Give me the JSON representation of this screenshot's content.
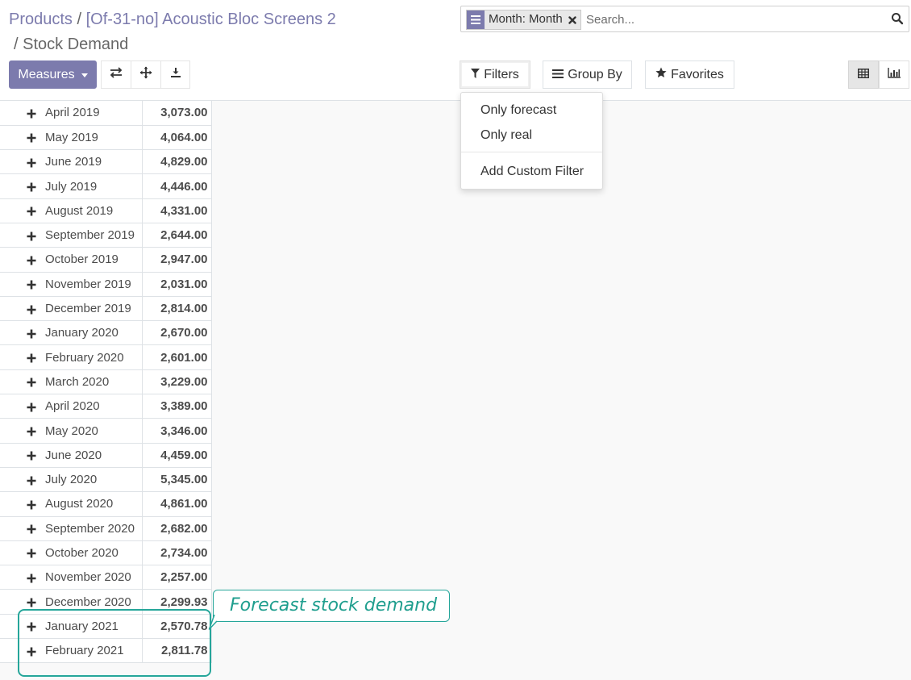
{
  "breadcrumb": {
    "root": "Products",
    "sep1": "/",
    "product": "[Of-31-no] Acoustic Bloc Screens 2",
    "sep2": "/",
    "current": "Stock Demand"
  },
  "search": {
    "facet_value": "Month: Month",
    "placeholder": "Search..."
  },
  "toolbar": {
    "measures_label": "Measures",
    "flip_icon": "flip-axis-icon",
    "expand_icon": "expand-all-icon",
    "download_icon": "download-icon"
  },
  "search_options": {
    "filters_label": "Filters",
    "group_by_label": "Group By",
    "favorites_label": "Favorites"
  },
  "filters_dropdown": {
    "items": [
      "Only forecast",
      "Only real"
    ],
    "custom_filter_label": "Add Custom Filter"
  },
  "view_switcher": {
    "pivot_icon": "table-icon",
    "graph_icon": "bar-chart-icon"
  },
  "pivot": {
    "rows": [
      {
        "label": "April 2019",
        "value": "3,073.00"
      },
      {
        "label": "May 2019",
        "value": "4,064.00"
      },
      {
        "label": "June 2019",
        "value": "4,829.00"
      },
      {
        "label": "July 2019",
        "value": "4,446.00"
      },
      {
        "label": "August 2019",
        "value": "4,331.00"
      },
      {
        "label": "September 2019",
        "value": "2,644.00"
      },
      {
        "label": "October 2019",
        "value": "2,947.00"
      },
      {
        "label": "November 2019",
        "value": "2,031.00"
      },
      {
        "label": "December 2019",
        "value": "2,814.00"
      },
      {
        "label": "January 2020",
        "value": "2,670.00"
      },
      {
        "label": "February 2020",
        "value": "2,601.00"
      },
      {
        "label": "March 2020",
        "value": "3,229.00"
      },
      {
        "label": "April 2020",
        "value": "3,389.00"
      },
      {
        "label": "May 2020",
        "value": "3,346.00"
      },
      {
        "label": "June 2020",
        "value": "4,459.00"
      },
      {
        "label": "July 2020",
        "value": "5,345.00"
      },
      {
        "label": "August 2020",
        "value": "4,861.00"
      },
      {
        "label": "September 2020",
        "value": "2,682.00"
      },
      {
        "label": "October 2020",
        "value": "2,734.00"
      },
      {
        "label": "November 2020",
        "value": "2,257.00"
      },
      {
        "label": "December 2020",
        "value": "2,299.93"
      },
      {
        "label": "January 2021",
        "value": "2,570.78"
      },
      {
        "label": "February 2021",
        "value": "2,811.78"
      }
    ]
  },
  "annotation": {
    "text": "Forecast stock demand",
    "color": "#26a69a"
  },
  "colors": {
    "brand": "#7c7bad",
    "annotation": "#26a69a"
  }
}
